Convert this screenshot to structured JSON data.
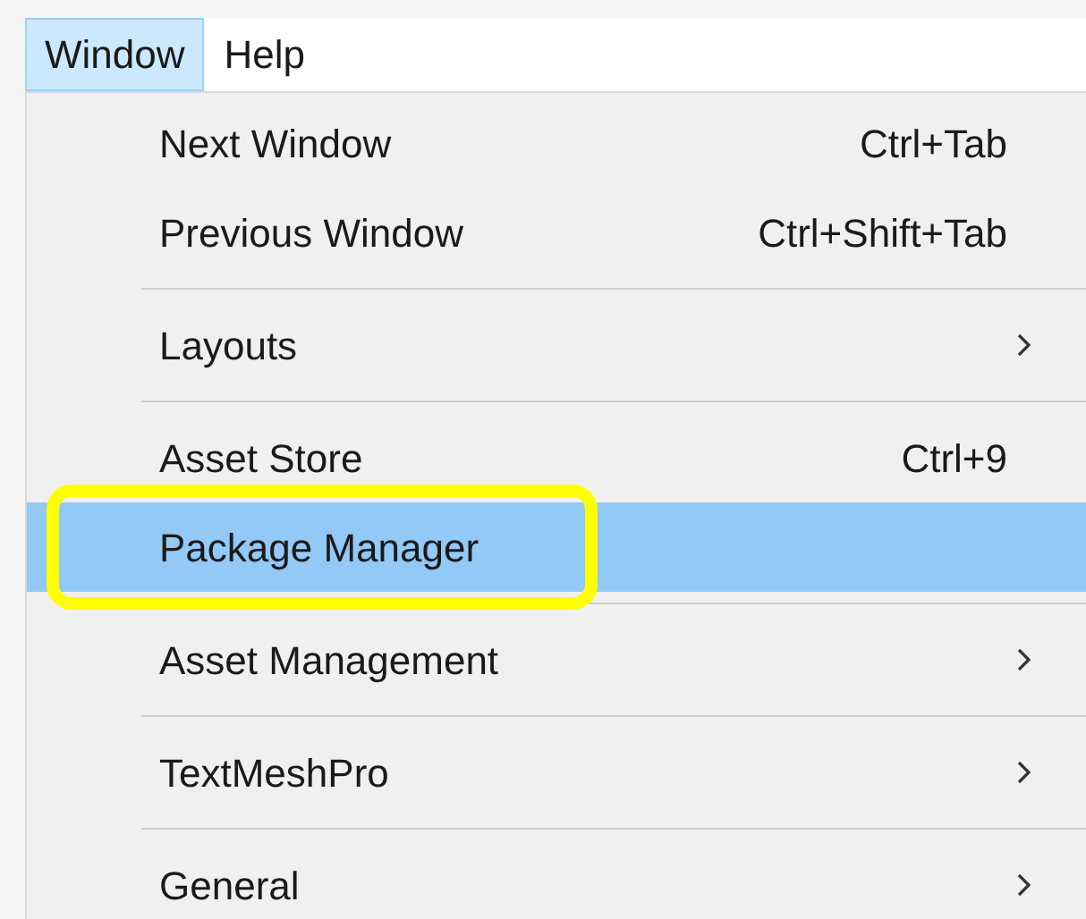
{
  "menubar": [
    {
      "label": "Window",
      "selected": true
    },
    {
      "label": "Help",
      "selected": false
    }
  ],
  "menu": [
    {
      "kind": "item",
      "label": "Next Window",
      "shortcut": "Ctrl+Tab",
      "submenu": false,
      "selected": false,
      "circled": false
    },
    {
      "kind": "item",
      "label": "Previous Window",
      "shortcut": "Ctrl+Shift+Tab",
      "submenu": false,
      "selected": false,
      "circled": false
    },
    {
      "kind": "separator"
    },
    {
      "kind": "item",
      "label": "Layouts",
      "submenu": true,
      "selected": false,
      "circled": false
    },
    {
      "kind": "separator"
    },
    {
      "kind": "item",
      "label": "Asset Store",
      "shortcut": "Ctrl+9",
      "submenu": false,
      "selected": false,
      "circled": false
    },
    {
      "kind": "item",
      "label": "Package Manager",
      "submenu": false,
      "selected": true,
      "circled": true
    },
    {
      "kind": "separator"
    },
    {
      "kind": "item",
      "label": "Asset Management",
      "submenu": true,
      "selected": false,
      "circled": false
    },
    {
      "kind": "separator"
    },
    {
      "kind": "item",
      "label": "TextMeshPro",
      "submenu": true,
      "selected": false,
      "circled": false
    },
    {
      "kind": "separator"
    },
    {
      "kind": "item",
      "label": "General",
      "submenu": true,
      "selected": false,
      "circled": false
    }
  ]
}
